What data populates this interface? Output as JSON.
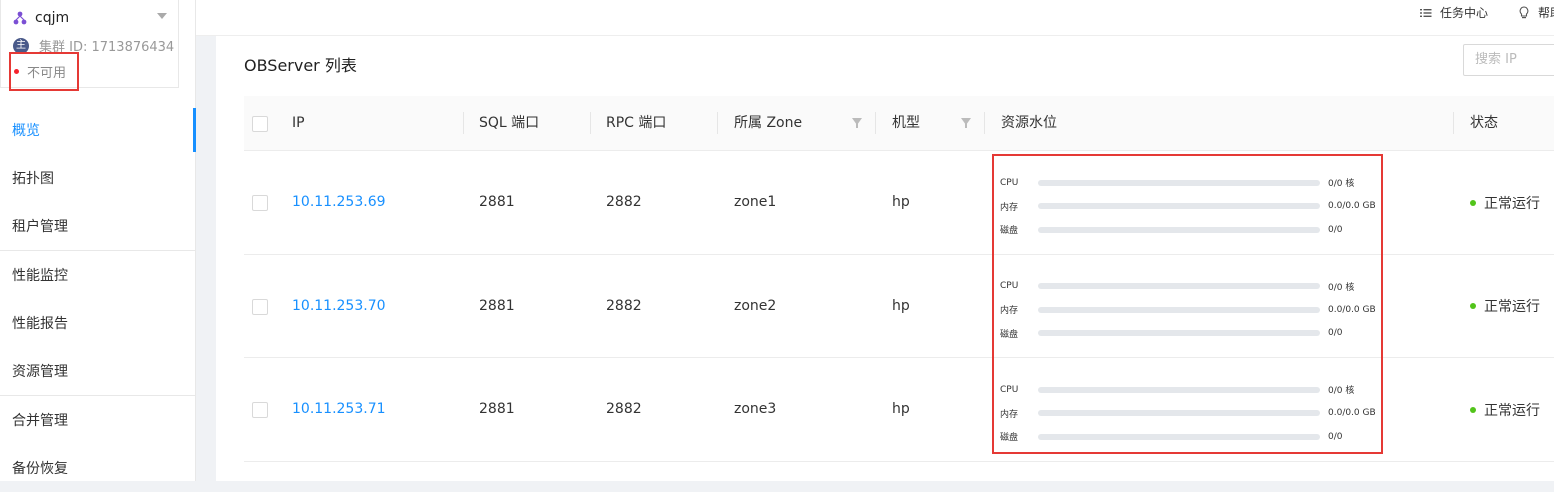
{
  "cluster": {
    "name": "cqjm",
    "id_text": "集群 ID: 1713876434",
    "status": "不可用"
  },
  "sidebar": {
    "items": [
      {
        "label": "概览",
        "active": true
      },
      {
        "label": "拓扑图"
      },
      {
        "label": "租户管理"
      },
      {
        "label": "性能监控"
      },
      {
        "label": "性能报告"
      },
      {
        "label": "资源管理"
      },
      {
        "label": "合并管理"
      },
      {
        "label": "备份恢复"
      }
    ]
  },
  "topbar": {
    "task_center": "任务中心",
    "help": "帮助"
  },
  "panel": {
    "title": "OBServer 列表",
    "search_placeholder": "搜索 IP"
  },
  "table": {
    "headers": {
      "ip": "IP",
      "sql_port": "SQL 端口",
      "rpc_port": "RPC 端口",
      "zone": "所属 Zone",
      "model": "机型",
      "resource": "资源水位",
      "state": "状态"
    },
    "rows": [
      {
        "ip": "10.11.253.69",
        "sql_port": "2881",
        "rpc_port": "2882",
        "zone": "zone1",
        "model": "hp",
        "cpu_label": "CPU",
        "cpu_value": "0/0 核",
        "mem_label": "内存",
        "mem_value": "0.0/0.0 GB",
        "disk_label": "磁盘",
        "disk_value": "0/0",
        "state": "正常运行"
      },
      {
        "ip": "10.11.253.70",
        "sql_port": "2881",
        "rpc_port": "2882",
        "zone": "zone2",
        "model": "hp",
        "cpu_label": "CPU",
        "cpu_value": "0/0 核",
        "mem_label": "内存",
        "mem_value": "0.0/0.0 GB",
        "disk_label": "磁盘",
        "disk_value": "0/0",
        "state": "正常运行"
      },
      {
        "ip": "10.11.253.71",
        "sql_port": "2881",
        "rpc_port": "2882",
        "zone": "zone3",
        "model": "hp",
        "cpu_label": "CPU",
        "cpu_value": "0/0 核",
        "mem_label": "内存",
        "mem_value": "0.0/0.0 GB",
        "disk_label": "磁盘",
        "disk_value": "0/0",
        "state": "正常运行"
      }
    ]
  },
  "colors": {
    "accent": "#1890ff",
    "success": "#52c41a",
    "error": "#f5222d",
    "annotation": "#e53935"
  }
}
